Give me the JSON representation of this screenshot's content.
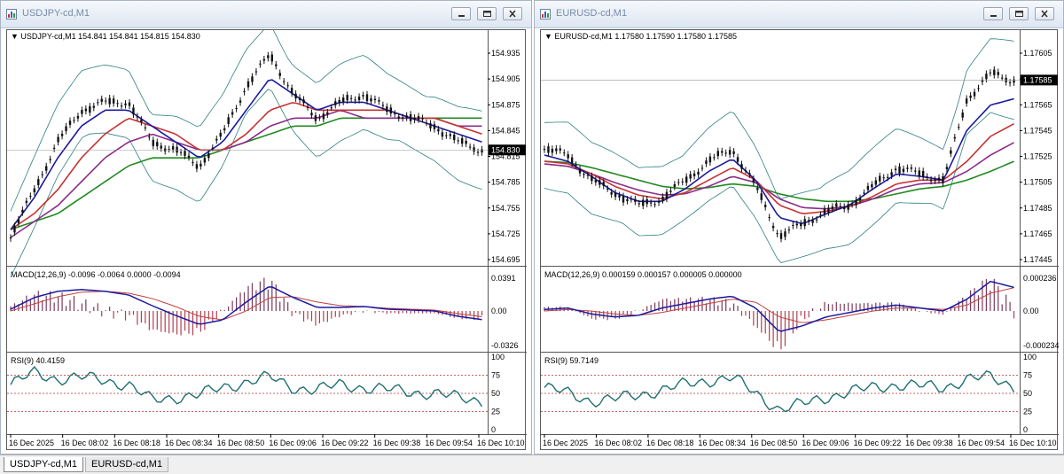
{
  "windows": [
    {
      "title": "USDJPY-cd,M1",
      "header": "▼ USDJPY-cd,M1  154.841 154.841 154.815 154.830",
      "price_labels": [
        "154.935",
        "154.905",
        "154.875",
        "154.845",
        "154.815",
        "154.785",
        "154.755",
        "154.725",
        "154.695"
      ],
      "current_price": "154.830",
      "macd_header": "MACD(12,26,9) -0.0096 -0.0064 0.0000 -0.0094",
      "macd_labels": [
        "0.0391",
        "0.00",
        "-0.0326"
      ],
      "rsi_header": "RSI(9) 40.4159",
      "rsi_labels": [
        "100",
        "75",
        "50",
        "25",
        "0"
      ],
      "time_labels": [
        "16 Dec 2025",
        "16 Dec 08:02",
        "16 Dec 08:18",
        "16 Dec 08:34",
        "16 Dec 08:50",
        "16 Dec 09:06",
        "16 Dec 09:22",
        "16 Dec 09:38",
        "16 Dec 09:54",
        "16 Dec 10:10"
      ]
    },
    {
      "title": "EURUSD-cd,M1",
      "header": "▼ EURUSD-cd,M1  1.17580 1.17590 1.17580 1.17585",
      "price_labels": [
        "1.17605",
        "1.17585",
        "1.17565",
        "1.17545",
        "1.17525",
        "1.17505",
        "1.17485",
        "1.17465",
        "1.17445"
      ],
      "current_price": "1.17585",
      "macd_header": "MACD(12,26,9) 0.000159 0.000157 0.000005 0.000000",
      "macd_labels": [
        "0.000236",
        "0.00",
        "-0.000234"
      ],
      "rsi_header": "RSI(9) 59.7149",
      "rsi_labels": [
        "100",
        "75",
        "50",
        "25",
        "0"
      ],
      "time_labels": [
        "16 Dec 2025",
        "16 Dec 08:02",
        "16 Dec 08:18",
        "16 Dec 08:34",
        "16 Dec 08:50",
        "16 Dec 09:06",
        "16 Dec 09:22",
        "16 Dec 09:38",
        "16 Dec 09:54",
        "16 Dec 10:10"
      ]
    }
  ],
  "tabs": [
    "USDJPY-cd,M1",
    "EURUSD-cd,M1"
  ],
  "chart_data": [
    {
      "type": "line",
      "title": "USDJPY-cd,M1",
      "x": [
        "16 Dec 2025",
        "16 Dec 08:02",
        "16 Dec 08:18",
        "16 Dec 08:34",
        "16 Dec 08:50",
        "16 Dec 09:06",
        "16 Dec 09:22",
        "16 Dec 09:38",
        "16 Dec 09:54",
        "16 Dec 10:10"
      ],
      "ylim": [
        154.69,
        154.965
      ],
      "price_path": [
        154.72,
        154.78,
        154.84,
        154.88,
        154.89,
        154.89,
        154.84,
        154.83,
        154.81,
        154.85,
        154.91,
        154.95,
        154.9,
        154.87,
        154.89,
        154.9,
        154.88,
        154.87,
        154.86,
        154.84,
        154.83
      ],
      "ma_fast": [
        154.73,
        154.77,
        154.82,
        154.86,
        154.88,
        154.88,
        154.86,
        154.84,
        154.82,
        154.84,
        154.88,
        154.92,
        154.9,
        154.88,
        154.89,
        154.89,
        154.88,
        154.87,
        154.86,
        154.85,
        154.84
      ],
      "ma_mid": [
        154.73,
        154.75,
        154.78,
        154.82,
        154.85,
        154.87,
        154.86,
        154.85,
        154.83,
        154.83,
        154.85,
        154.88,
        154.89,
        154.88,
        154.88,
        154.88,
        154.88,
        154.87,
        154.87,
        154.86,
        154.85
      ],
      "ma_slow": [
        154.72,
        154.74,
        154.76,
        154.79,
        154.82,
        154.84,
        154.85,
        154.84,
        154.83,
        154.83,
        154.84,
        154.86,
        154.87,
        154.87,
        154.88,
        154.87,
        154.87,
        154.87,
        154.87,
        154.86,
        154.86
      ],
      "ma_long": [
        154.73,
        154.74,
        154.75,
        154.77,
        154.79,
        154.81,
        154.82,
        154.82,
        154.82,
        154.83,
        154.84,
        154.85,
        154.86,
        154.86,
        154.87,
        154.87,
        154.87,
        154.87,
        154.87,
        154.87,
        154.87
      ],
      "macd_ylim": [
        -0.0326,
        0.0391
      ],
      "macd": [
        0.002,
        0.015,
        0.022,
        0.024,
        0.022,
        0.018,
        0.006,
        -0.005,
        -0.015,
        -0.01,
        0.01,
        0.028,
        0.015,
        0.004,
        0.004,
        0.005,
        0.002,
        0.001,
        0.0,
        -0.006,
        -0.0096
      ],
      "macd_signal": [
        0.0,
        0.008,
        0.016,
        0.021,
        0.022,
        0.02,
        0.014,
        0.005,
        -0.006,
        -0.01,
        0.0,
        0.015,
        0.016,
        0.01,
        0.006,
        0.005,
        0.003,
        0.002,
        0.001,
        -0.003,
        -0.0064
      ],
      "rsi": [
        62,
        78,
        70,
        72,
        68,
        62,
        40,
        45,
        48,
        58,
        66,
        72,
        58,
        55,
        62,
        58,
        55,
        52,
        50,
        44,
        40
      ],
      "rsi_levels": [
        75,
        50,
        25
      ]
    },
    {
      "type": "line",
      "title": "EURUSD-cd,M1",
      "x": [
        "16 Dec 2025",
        "16 Dec 08:02",
        "16 Dec 08:18",
        "16 Dec 08:34",
        "16 Dec 08:50",
        "16 Dec 09:06",
        "16 Dec 09:22",
        "16 Dec 09:38",
        "16 Dec 09:54",
        "16 Dec 10:10"
      ],
      "ylim": [
        1.1744,
        1.17615
      ],
      "price_path": [
        1.1753,
        1.17525,
        1.17505,
        1.17495,
        1.17485,
        1.1749,
        1.17505,
        1.1752,
        1.1753,
        1.175,
        1.1746,
        1.1747,
        1.1748,
        1.17485,
        1.175,
        1.17515,
        1.1751,
        1.17505,
        1.1757,
        1.1759,
        1.17585
      ],
      "ma_fast": [
        1.17525,
        1.1752,
        1.17508,
        1.17495,
        1.17488,
        1.17488,
        1.17498,
        1.17512,
        1.17522,
        1.17505,
        1.17475,
        1.1747,
        1.17478,
        1.17485,
        1.17498,
        1.1751,
        1.17508,
        1.17505,
        1.17545,
        1.17565,
        1.1757
      ],
      "ma_mid": [
        1.1752,
        1.17518,
        1.1751,
        1.175,
        1.17493,
        1.1749,
        1.17495,
        1.17505,
        1.17515,
        1.17505,
        1.17485,
        1.17478,
        1.1748,
        1.17484,
        1.17492,
        1.17502,
        1.17505,
        1.17505,
        1.1752,
        1.1754,
        1.1755
      ],
      "ma_slow": [
        1.17518,
        1.17516,
        1.1751,
        1.17503,
        1.17497,
        1.17493,
        1.17494,
        1.175,
        1.17508,
        1.17503,
        1.1749,
        1.17483,
        1.17482,
        1.17484,
        1.1749,
        1.17498,
        1.17502,
        1.17503,
        1.17512,
        1.17525,
        1.17535
      ],
      "ma_long": [
        1.1752,
        1.17519,
        1.17515,
        1.1751,
        1.17505,
        1.175,
        1.17498,
        1.17499,
        1.17502,
        1.175,
        1.17494,
        1.1749,
        1.17488,
        1.17488,
        1.1749,
        1.17494,
        1.17498,
        1.175,
        1.17505,
        1.17512,
        1.1752
      ],
      "macd_ylim": [
        -0.000234,
        0.000236
      ],
      "macd": [
        1e-05,
        2e-05,
        -2e-05,
        -4e-05,
        -3e-05,
        2e-05,
        5e-05,
        8e-05,
        0.0001,
        2e-05,
        -0.00014,
        -0.0001,
        -4e-05,
        -1e-05,
        2e-05,
        4e-05,
        2e-05,
        0.0,
        8e-05,
        0.0002,
        0.000159
      ],
      "macd_signal": [
        0.0,
        1e-05,
        0.0,
        -2e-05,
        -3e-05,
        -1e-05,
        2e-05,
        5e-05,
        8e-05,
        6e-05,
        -4e-05,
        -8e-05,
        -6e-05,
        -3e-05,
        0.0,
        2e-05,
        2e-05,
        1e-05,
        4e-05,
        0.00012,
        0.000157
      ],
      "rsi": [
        58,
        50,
        40,
        42,
        48,
        55,
        62,
        68,
        72,
        50,
        28,
        35,
        45,
        52,
        58,
        62,
        60,
        58,
        70,
        72,
        60
      ],
      "rsi_levels": [
        75,
        50,
        25
      ]
    }
  ]
}
